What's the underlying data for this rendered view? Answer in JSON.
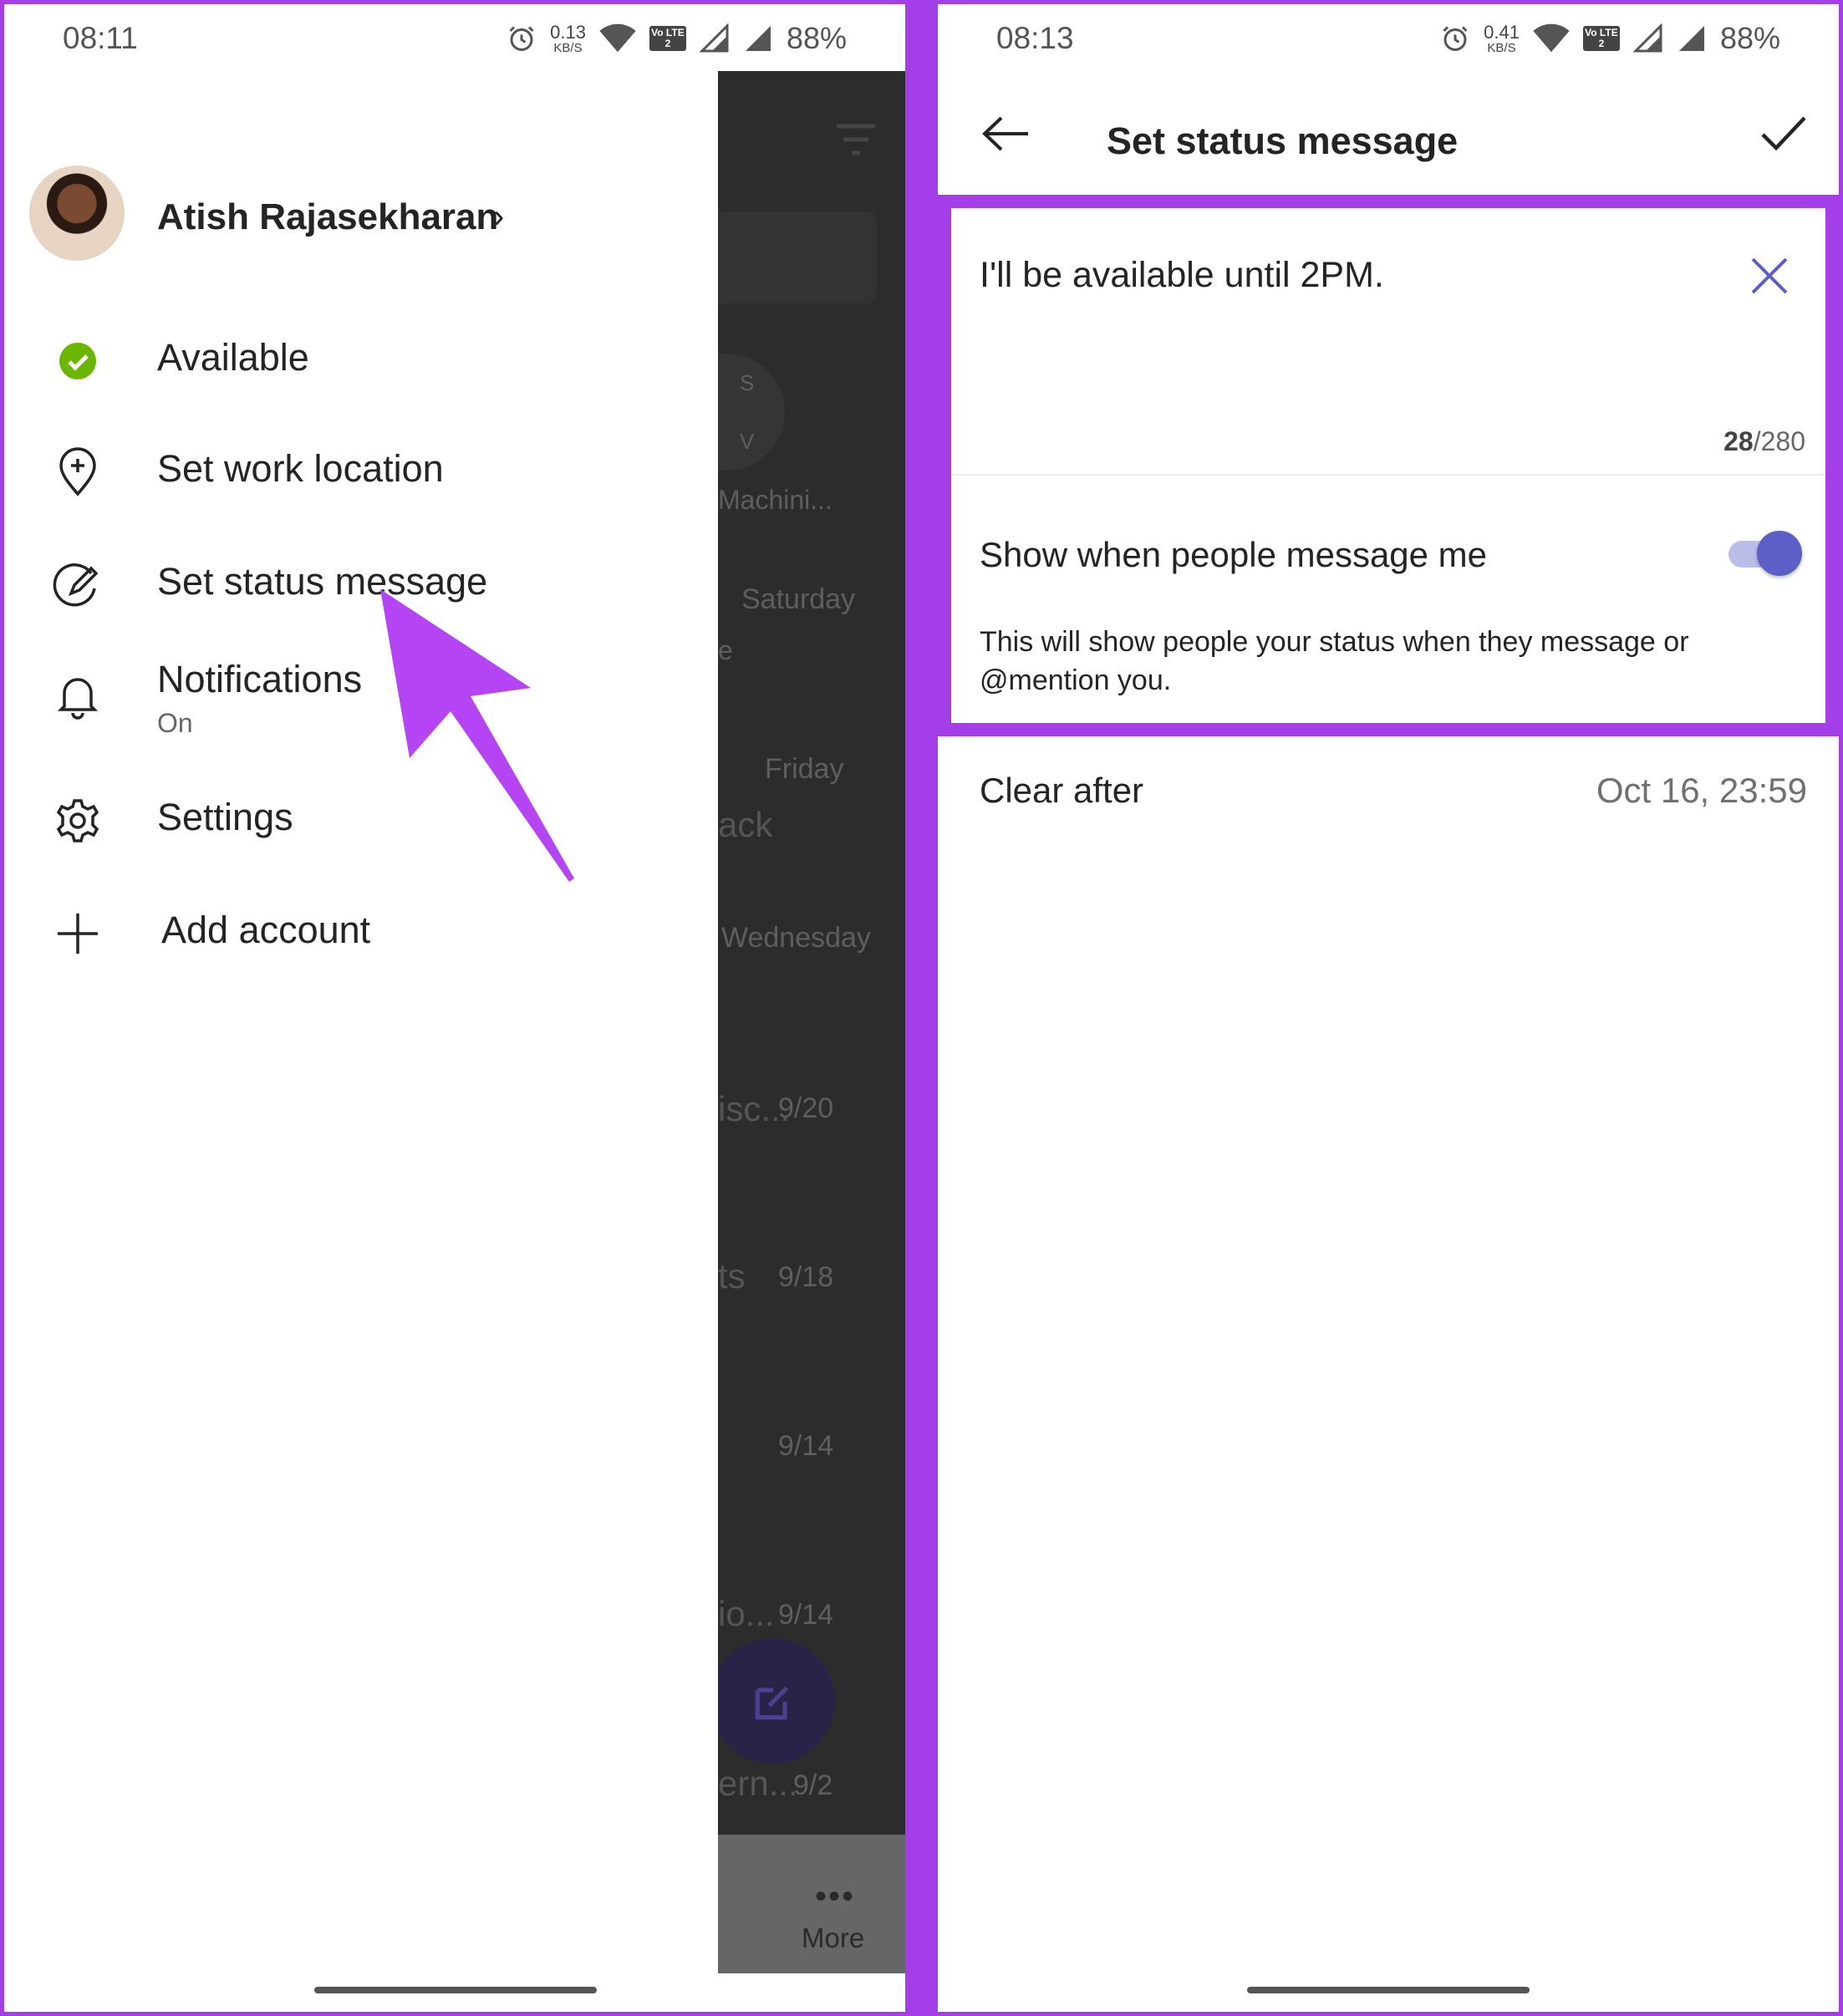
{
  "left": {
    "status_bar": {
      "time": "08:11",
      "speed_value": "0.13",
      "speed_unit": "KB/S",
      "lte": "Vo LTE 2",
      "battery": "88%"
    },
    "profile": {
      "name": "Atish Rajasekharan",
      "chevron": "›"
    },
    "menu": [
      {
        "label": "Available",
        "icon": "available-check-icon"
      },
      {
        "label": "Set work location",
        "icon": "location-plus-icon"
      },
      {
        "label": "Set status message",
        "icon": "edit-pen-icon"
      },
      {
        "label": "Notifications",
        "sublabel": "On",
        "icon": "bell-icon"
      },
      {
        "label": "Settings",
        "icon": "gear-icon"
      },
      {
        "label": "Add account",
        "icon": "plus-icon"
      }
    ],
    "background_list": {
      "ghost_texts": [
        "S",
        "V",
        "Machini...",
        "Saturday",
        "e",
        "Friday",
        "ack",
        "Wednesday",
        "isc...",
        "9/20",
        "ts",
        "9/18",
        "9/14",
        "io...",
        "9/14",
        "ern...",
        "9/2"
      ],
      "more_label": "More"
    }
  },
  "right": {
    "status_bar": {
      "time": "08:13",
      "speed_value": "0.41",
      "speed_unit": "KB/S",
      "lte": "Vo LTE 2",
      "battery": "88%"
    },
    "title": "Set status message",
    "message": "I'll be available until 2PM.",
    "counter_current": "28",
    "counter_max": "/280",
    "toggle_label": "Show when people message me",
    "toggle_on": true,
    "description": "This will show people your status when they message or @mention you.",
    "clear_after_label": "Clear after",
    "clear_after_value": "Oct 16, 23:59"
  },
  "colors": {
    "highlight": "#a33ee8",
    "accent": "#5b5fc7",
    "available": "#6bb700"
  }
}
